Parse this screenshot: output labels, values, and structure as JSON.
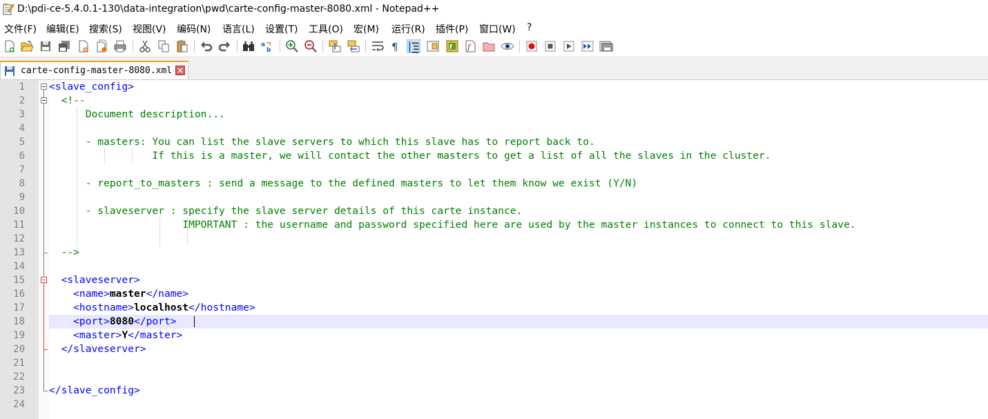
{
  "window": {
    "title": "D:\\pdi-ce-5.4.0.1-130\\data-integration\\pwd\\carte-config-master-8080.xml - Notepad++"
  },
  "menu": [
    "文件(F)",
    "编辑(E)",
    "搜索(S)",
    "视图(V)",
    "编码(N)",
    "语言(L)",
    "设置(T)",
    "工具(O)",
    "宏(M)",
    "运行(R)",
    "插件(P)",
    "窗口(W)",
    "?"
  ],
  "toolbar": {
    "buttons": [
      "new-file",
      "open-file",
      "save",
      "save-all",
      "close",
      "close-all",
      "print",
      "cut",
      "copy",
      "paste",
      "undo",
      "redo",
      "find",
      "replace",
      "zoom-in",
      "zoom-out",
      "sync-vertical",
      "sync-horizontal",
      "word-wrap",
      "show-all-characters",
      "indent-guide",
      "document-map",
      "function-list",
      "folder-as-workspace",
      "monitoring",
      "record-macro",
      "stop-recording",
      "play-macro",
      "run-macro-multiple",
      "save-macro"
    ],
    "active": "indent-guide"
  },
  "tab": {
    "label": "carte-config-master-8080.xml",
    "close_symbol": "×"
  },
  "editor": {
    "line_numbers": [
      "1",
      "2",
      "3",
      "4",
      "5",
      "6",
      "7",
      "8",
      "9",
      "10",
      "11",
      "12",
      "13",
      "14",
      "15",
      "16",
      "17",
      "18",
      "19",
      "20",
      "21",
      "22",
      "23",
      "24"
    ],
    "current_line": 18,
    "lines": [
      [
        {
          "t": "tag",
          "v": "<slave_config>"
        }
      ],
      [
        {
          "t": "cmt",
          "v": "  <!--"
        }
      ],
      [
        {
          "t": "cmt",
          "v": "      Document description..."
        }
      ],
      [],
      [
        {
          "t": "cmt",
          "v": "      - masters: You can list the slave servers to which this slave has to report back to."
        }
      ],
      [
        {
          "t": "cmt",
          "v": "                 If this is a master, we will contact the other masters to get a list of all the slaves in the cluster."
        }
      ],
      [],
      [
        {
          "t": "cmt",
          "v": "      - report_to_masters : send a message to the defined masters to let them know we exist (Y/N)"
        }
      ],
      [],
      [
        {
          "t": "cmt",
          "v": "      - slaveserver : specify the slave server details of this carte instance."
        }
      ],
      [
        {
          "t": "cmt",
          "v": "                      IMPORTANT : the username and password specified here are used by the master instances to connect to this slave."
        }
      ],
      [],
      [
        {
          "t": "cmt",
          "v": "  -->"
        }
      ],
      [],
      [
        {
          "t": "tag",
          "v": "  <slaveserver>"
        }
      ],
      [
        {
          "t": "tag",
          "v": "    <name>"
        },
        {
          "t": "val",
          "v": "master"
        },
        {
          "t": "tag",
          "v": "</name>"
        }
      ],
      [
        {
          "t": "tag",
          "v": "    <hostname>"
        },
        {
          "t": "val",
          "v": "localhost"
        },
        {
          "t": "tag",
          "v": "</hostname>"
        }
      ],
      [
        {
          "t": "tag",
          "v": "    <port>"
        },
        {
          "t": "val",
          "v": "8080"
        },
        {
          "t": "tag",
          "v": "</port>"
        }
      ],
      [
        {
          "t": "tag",
          "v": "    <master>"
        },
        {
          "t": "val",
          "v": "Y"
        },
        {
          "t": "tag",
          "v": "</master>"
        }
      ],
      [
        {
          "t": "tag",
          "v": "  </slaveserver>"
        }
      ],
      [],
      [],
      [
        {
          "t": "tag",
          "v": "</slave_config>"
        }
      ],
      []
    ]
  },
  "colors": {
    "tag": "#0000ff",
    "comment": "#008000",
    "value": "#000000",
    "line_number": "#808080",
    "current_line": "#e8e8ff",
    "tab_accent": "#f59a23"
  }
}
